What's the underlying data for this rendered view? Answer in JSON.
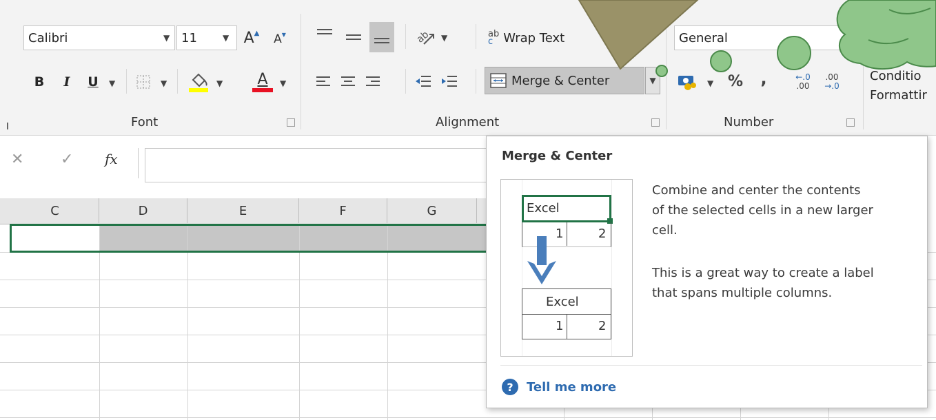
{
  "ribbon": {
    "font": {
      "name_value": "Calibri",
      "size_value": "11",
      "bold": "B",
      "italic": "I",
      "underline": "U",
      "grow_letter": "A",
      "shrink_letter": "A",
      "font_color_letter": "A",
      "group_label": "Font"
    },
    "alignment": {
      "wrap_text": "Wrap Text",
      "wrap_glyph_top": "ab",
      "wrap_glyph_bottom": "c",
      "merge_center": "Merge & Center",
      "group_label": "Alignment"
    },
    "number": {
      "format_value": "General",
      "percent": "%",
      "comma": ",",
      "inc_top": "←.0",
      "inc_bottom": ".00",
      "dec_top": ".00",
      "dec_bottom": "→.0",
      "group_label": "Number"
    },
    "styles": {
      "conditional_line1": "Conditio",
      "conditional_line2": "Formattir"
    }
  },
  "formula_bar": {
    "cancel": "✕",
    "enter": "✓",
    "fx": "fx"
  },
  "grid": {
    "columns": [
      "C",
      "D",
      "E",
      "F",
      "G"
    ]
  },
  "tooltip": {
    "title": "Merge & Center",
    "description": [
      "Combine and center the contents",
      "of the selected cells in a new larger",
      "cell."
    ],
    "tip": [
      "This is a great way to create a label",
      "that spans multiple columns."
    ],
    "illustration": {
      "before_label": "Excel",
      "before_values": [
        "1",
        "2"
      ],
      "after_label": "Excel",
      "after_values": [
        "1",
        "2"
      ]
    },
    "help_glyph": "?",
    "tell_me_more": "Tell me more"
  },
  "colors": {
    "selection_green": "#217346",
    "arrow_blue": "#4a7ebb",
    "callout_fill": "#9a9268",
    "cloud_fill": "#8fc68a",
    "cloud_stroke": "#4a8a4a",
    "font_color_red": "#e81123",
    "highlight_yellow": "#ffff00",
    "help_blue": "#2e6bb0"
  }
}
